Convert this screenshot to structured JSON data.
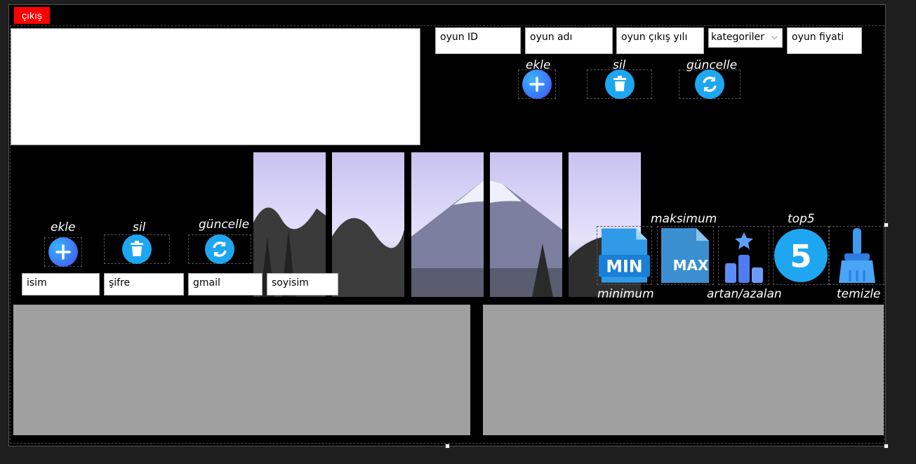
{
  "window": {
    "exit_label": "çıkış"
  },
  "game_form": {
    "id_field": "oyun ID",
    "name_field": "oyun adı",
    "year_field": "oyun çıkış yılı",
    "category_select": "kategoriler",
    "price_field": "oyun fiyati",
    "add_label": "ekle",
    "delete_label": "sil",
    "update_label": "güncelle"
  },
  "user_form": {
    "name_field": "isim",
    "password_field": "şifre",
    "gmail_field": "gmail",
    "surname_field": "soyisim",
    "add_label": "ekle",
    "delete_label": "sil",
    "update_label": "güncelle"
  },
  "stats_buttons": {
    "minimum_label": "minimum",
    "maximum_label": "maksimum",
    "sort_label": "artan/azalan",
    "top5_label": "top5",
    "clear_label": "temizle",
    "min_icon_text": "MIN",
    "max_icon_text": "MAX",
    "top5_icon_text": "5"
  },
  "colors": {
    "exit_bg": "#ff0000",
    "form_bg": "#000000",
    "grid_bg": "#a0a0a0",
    "icon_blue": "#1ea7f0"
  }
}
